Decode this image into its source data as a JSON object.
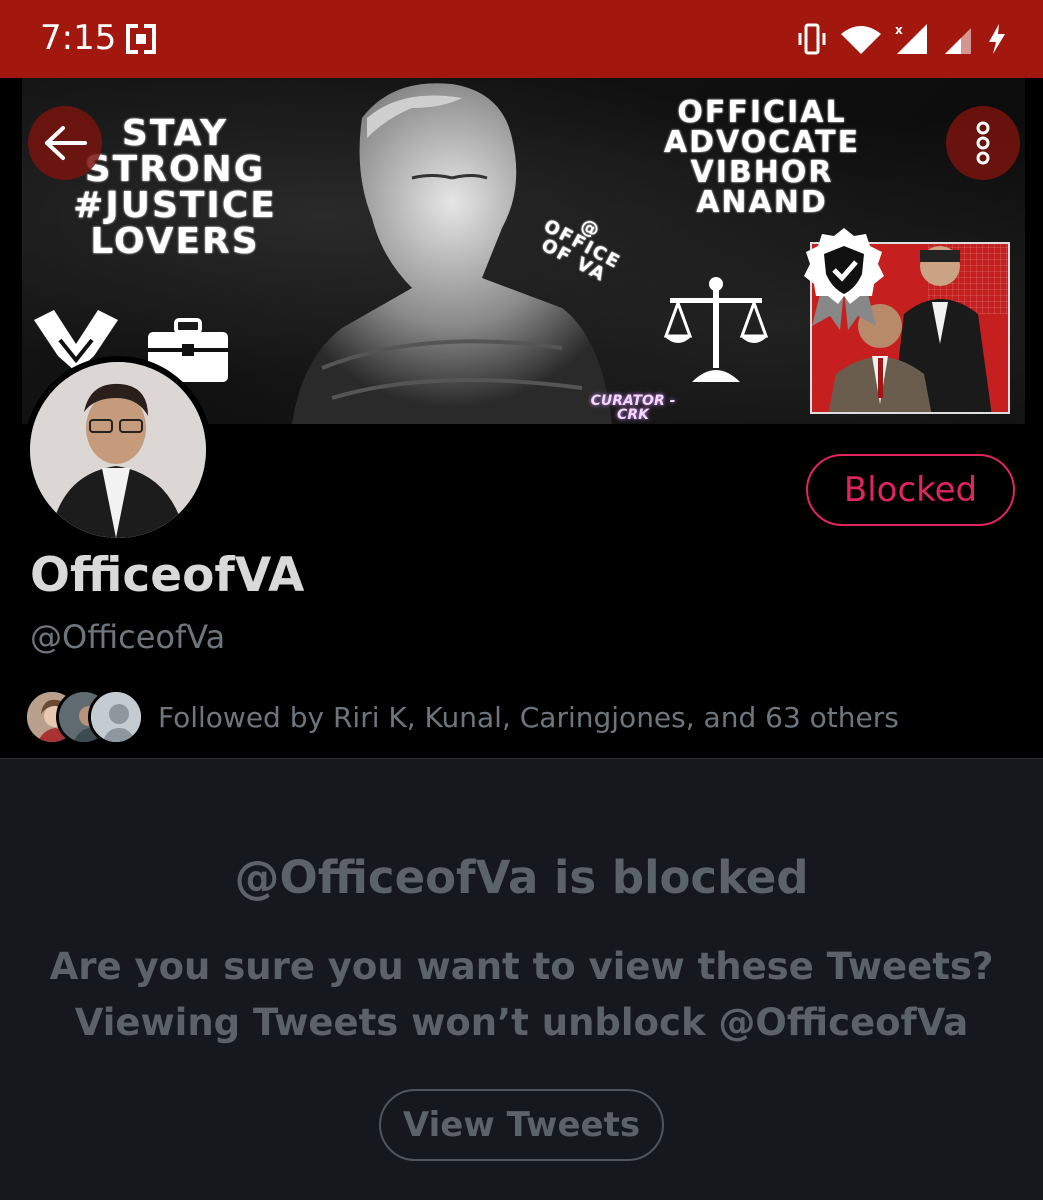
{
  "status_bar": {
    "time": "7:15",
    "icons": [
      "app-icon",
      "vibrate-icon",
      "wifi-icon",
      "signal-x-icon",
      "signal-icon",
      "charging-icon"
    ],
    "background": "#a3180e"
  },
  "banner": {
    "left_text": [
      "STAY",
      "STRONG",
      "#JUSTICE",
      "LOVERS"
    ],
    "right_text": [
      "OFFICIAL",
      "ADVOCATE",
      "VIBHOR",
      "ANAND"
    ],
    "office_text": [
      "@",
      "OFFICE",
      "OF VA"
    ],
    "curator": "CURATOR - CRK"
  },
  "nav": {
    "back_icon": "arrow-left-icon",
    "more_icon": "more-vertical-icon"
  },
  "profile": {
    "display_name": "OfficeofVA",
    "handle": "@OfficeofVa",
    "blocked_label": "Blocked",
    "followed_by": "Followed by Riri K, Kunal, Caringjones, and 63 others"
  },
  "blocked_notice": {
    "title": "@OfficeofVa is blocked",
    "line1": "Are you sure you want to view these Tweets?",
    "line2": "Viewing Tweets won’t unblock @OfficeofVa",
    "button": "View Tweets"
  },
  "colors": {
    "accent_red": "#e0245e",
    "muted_text": "#6e767d",
    "panel_bg": "#15181c"
  }
}
